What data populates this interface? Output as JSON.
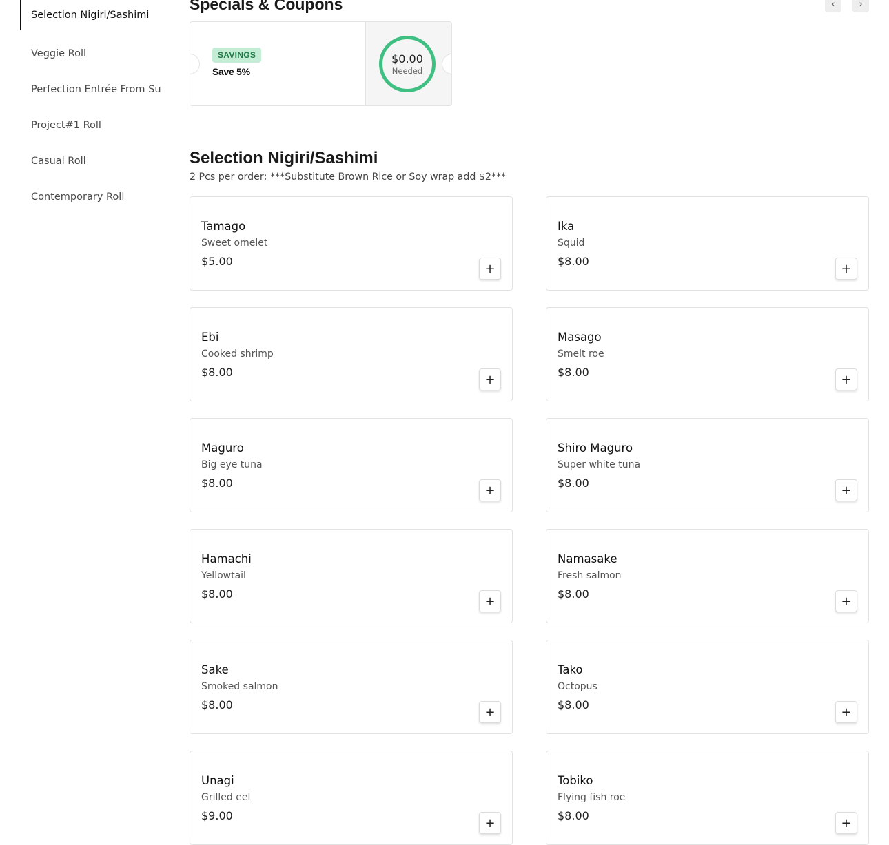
{
  "sidebar": {
    "items": [
      {
        "label": "Selection Nigiri/Sashimi",
        "active": true
      },
      {
        "label": "Veggie Roll"
      },
      {
        "label": "Perfection Entrée From Su"
      },
      {
        "label": "Project#1 Roll"
      },
      {
        "label": "Casual Roll"
      },
      {
        "label": "Contemporary Roll"
      }
    ]
  },
  "specials": {
    "title": "Specials & Coupons",
    "prev_icon": "‹",
    "next_icon": "›",
    "coupon": {
      "badge": "SAVINGS",
      "text": "Save 5%",
      "amount": "$0.00",
      "amount_label": "Needed",
      "ring_color": "#3fbf82",
      "badge_color": "#c5ecd5"
    }
  },
  "section": {
    "title": "Selection Nigiri/Sashimi",
    "description": "2 Pcs per order; ***Substitute Brown Rice or Soy wrap add $2***"
  },
  "items": [
    {
      "name": "Tamago",
      "desc": "Sweet omelet",
      "price": "$5.00"
    },
    {
      "name": "Ika",
      "desc": "Squid",
      "price": "$8.00"
    },
    {
      "name": "Ebi",
      "desc": "Cooked shrimp",
      "price": "$8.00"
    },
    {
      "name": "Masago",
      "desc": "Smelt roe",
      "price": "$8.00"
    },
    {
      "name": "Maguro",
      "desc": "Big eye tuna",
      "price": "$8.00"
    },
    {
      "name": "Shiro Maguro",
      "desc": "Super white tuna",
      "price": "$8.00"
    },
    {
      "name": "Hamachi",
      "desc": "Yellowtail",
      "price": "$8.00"
    },
    {
      "name": "Namasake",
      "desc": "Fresh salmon",
      "price": "$8.00"
    },
    {
      "name": "Sake",
      "desc": "Smoked salmon",
      "price": "$8.00"
    },
    {
      "name": "Tako",
      "desc": "Octopus",
      "price": "$8.00"
    },
    {
      "name": "Unagi",
      "desc": "Grilled eel",
      "price": "$9.00"
    },
    {
      "name": "Tobiko",
      "desc": "Flying fish roe",
      "price": "$8.00"
    }
  ],
  "add_icon": "+"
}
